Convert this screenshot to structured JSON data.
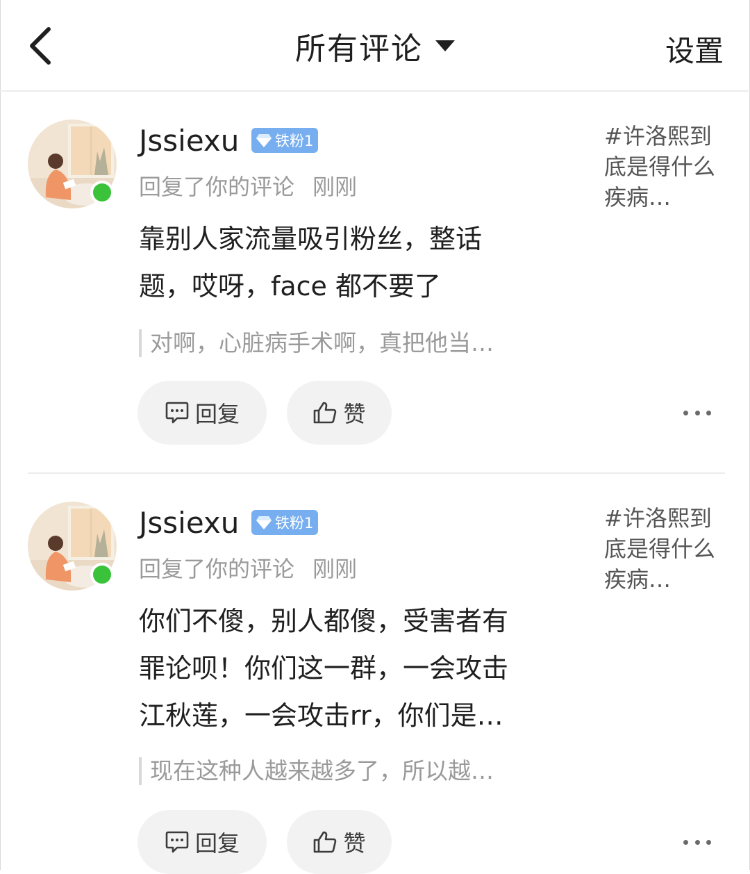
{
  "header": {
    "title": "所有评论",
    "settings_label": "设置"
  },
  "comments": [
    {
      "username": "Jssiexu",
      "badge": "铁粉1",
      "action": "回复了你的评论",
      "time": "刚刚",
      "topic": "#许洛熙到底是得什么疾病…",
      "body_lines": [
        "靠别人家流量吸引粉丝，整话",
        "题，哎呀，face 都不要了"
      ],
      "quote": "对啊，心脏病手术啊，真把他当…",
      "reply_label": "回复",
      "like_label": "赞"
    },
    {
      "username": "Jssiexu",
      "badge": "铁粉1",
      "action": "回复了你的评论",
      "time": "刚刚",
      "topic": "#许洛熙到底是得什么疾病…",
      "body_lines": [
        "你们不傻，别人都傻，受害者有",
        "罪论呗！你们这一群，一会攻击",
        "江秋莲，一会攻击rr，你们是…"
      ],
      "quote": "现在这种人越来越多了，所以越…",
      "reply_label": "回复",
      "like_label": "赞"
    }
  ],
  "colors": {
    "online": "#3ac33a",
    "badge": "#76aef0",
    "divider": "#ececec",
    "secondary_text": "#9a9a9a"
  },
  "icons": [
    "back-arrow-icon",
    "caret-down-icon",
    "diamond-icon",
    "comment-bubble-icon",
    "thumbs-up-icon",
    "more-dots-icon"
  ]
}
